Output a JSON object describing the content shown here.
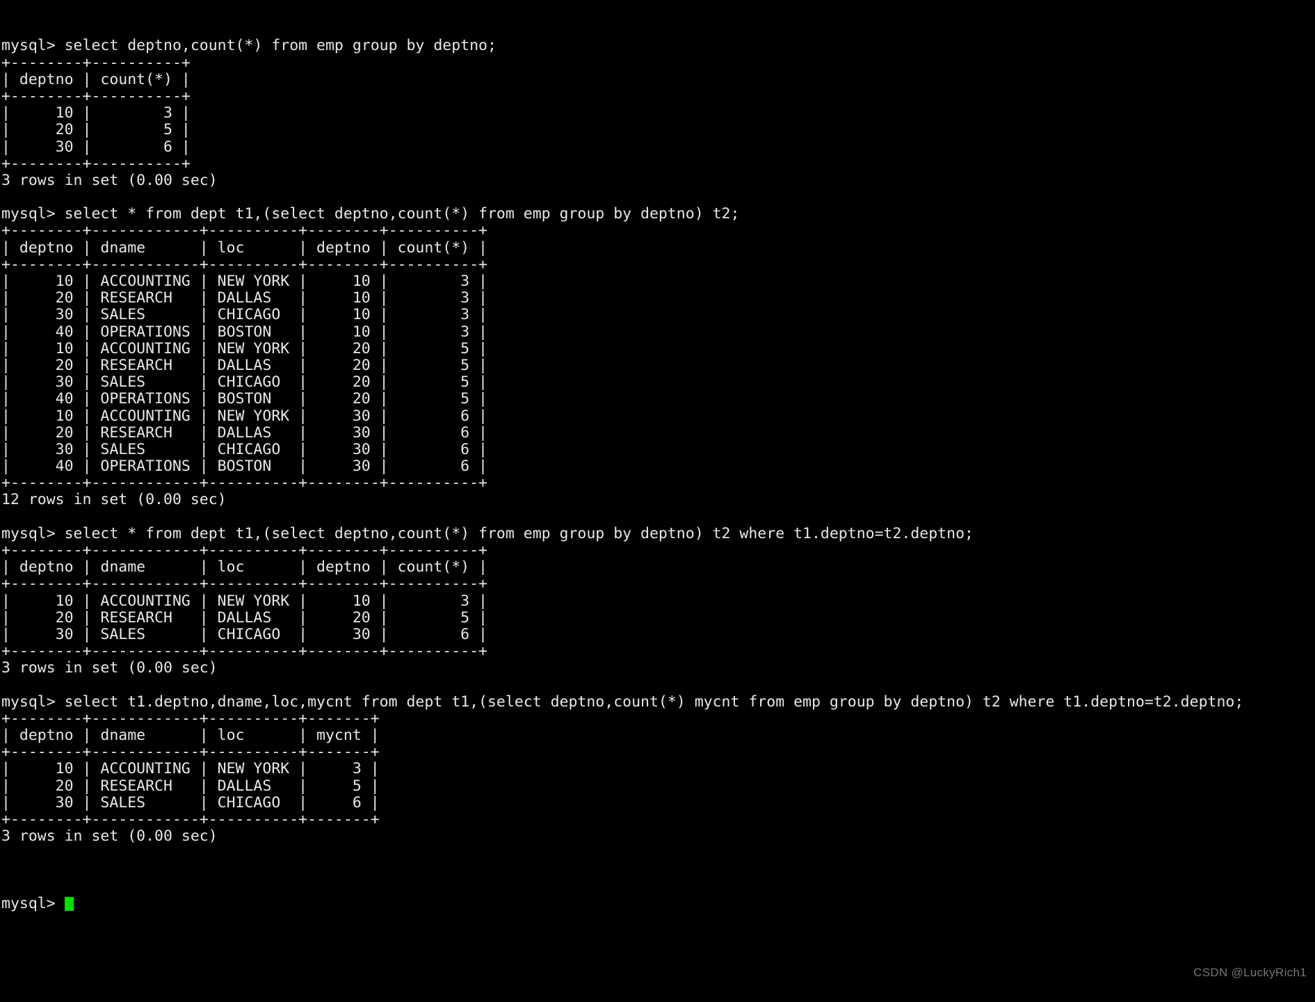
{
  "terminal": {
    "title": "mysql",
    "prompt": "mysql> ",
    "background_color": "#000000",
    "text_color": "#e8e8e8",
    "cursor_color": "#00e000",
    "lines": [
      "mysql> select deptno,count(*) from emp group by deptno;",
      "+--------+----------+",
      "| deptno | count(*) |",
      "+--------+----------+",
      "|     10 |        3 |",
      "|     20 |        5 |",
      "|     30 |        6 |",
      "+--------+----------+",
      "3 rows in set (0.00 sec)",
      "",
      "mysql> select * from dept t1,(select deptno,count(*) from emp group by deptno) t2;",
      "+--------+------------+----------+--------+----------+",
      "| deptno | dname      | loc      | deptno | count(*) |",
      "+--------+------------+----------+--------+----------+",
      "|     10 | ACCOUNTING | NEW YORK |     10 |        3 |",
      "|     20 | RESEARCH   | DALLAS   |     10 |        3 |",
      "|     30 | SALES      | CHICAGO  |     10 |        3 |",
      "|     40 | OPERATIONS | BOSTON   |     10 |        3 |",
      "|     10 | ACCOUNTING | NEW YORK |     20 |        5 |",
      "|     20 | RESEARCH   | DALLAS   |     20 |        5 |",
      "|     30 | SALES      | CHICAGO  |     20 |        5 |",
      "|     40 | OPERATIONS | BOSTON   |     20 |        5 |",
      "|     10 | ACCOUNTING | NEW YORK |     30 |        6 |",
      "|     20 | RESEARCH   | DALLAS   |     30 |        6 |",
      "|     30 | SALES      | CHICAGO  |     30 |        6 |",
      "|     40 | OPERATIONS | BOSTON   |     30 |        6 |",
      "+--------+------------+----------+--------+----------+",
      "12 rows in set (0.00 sec)",
      "",
      "mysql> select * from dept t1,(select deptno,count(*) from emp group by deptno) t2 where t1.deptno=t2.deptno;",
      "+--------+------------+----------+--------+----------+",
      "| deptno | dname      | loc      | deptno | count(*) |",
      "+--------+------------+----------+--------+----------+",
      "|     10 | ACCOUNTING | NEW YORK |     10 |        3 |",
      "|     20 | RESEARCH   | DALLAS   |     20 |        5 |",
      "|     30 | SALES      | CHICAGO  |     30 |        6 |",
      "+--------+------------+----------+--------+----------+",
      "3 rows in set (0.00 sec)",
      "",
      "mysql> select t1.deptno,dname,loc,mycnt from dept t1,(select deptno,count(*) mycnt from emp group by deptno) t2 where t1.deptno=t2.deptno;",
      "+--------+------------+----------+-------+",
      "| deptno | dname      | loc      | mycnt |",
      "+--------+------------+----------+-------+",
      "|     10 | ACCOUNTING | NEW YORK |     3 |",
      "|     20 | RESEARCH   | DALLAS   |     5 |",
      "|     30 | SALES      | CHICAGO  |     6 |",
      "+--------+------------+----------+-------+",
      "3 rows in set (0.00 sec)",
      ""
    ],
    "final_prompt": "mysql>"
  },
  "queries": [
    {
      "sql": "select deptno,count(*) from emp group by deptno;",
      "columns": [
        "deptno",
        "count(*)"
      ],
      "rows": [
        [
          "10",
          "3"
        ],
        [
          "20",
          "5"
        ],
        [
          "30",
          "6"
        ]
      ],
      "status": "3 rows in set (0.00 sec)"
    },
    {
      "sql": "select * from dept t1,(select deptno,count(*) from emp group by deptno) t2;",
      "columns": [
        "deptno",
        "dname",
        "loc",
        "deptno",
        "count(*)"
      ],
      "rows": [
        [
          "10",
          "ACCOUNTING",
          "NEW YORK",
          "10",
          "3"
        ],
        [
          "20",
          "RESEARCH",
          "DALLAS",
          "10",
          "3"
        ],
        [
          "30",
          "SALES",
          "CHICAGO",
          "10",
          "3"
        ],
        [
          "40",
          "OPERATIONS",
          "BOSTON",
          "10",
          "3"
        ],
        [
          "10",
          "ACCOUNTING",
          "NEW YORK",
          "20",
          "5"
        ],
        [
          "20",
          "RESEARCH",
          "DALLAS",
          "20",
          "5"
        ],
        [
          "30",
          "SALES",
          "CHICAGO",
          "20",
          "5"
        ],
        [
          "40",
          "OPERATIONS",
          "BOSTON",
          "20",
          "5"
        ],
        [
          "10",
          "ACCOUNTING",
          "NEW YORK",
          "30",
          "6"
        ],
        [
          "20",
          "RESEARCH",
          "DALLAS",
          "30",
          "6"
        ],
        [
          "30",
          "SALES",
          "CHICAGO",
          "30",
          "6"
        ],
        [
          "40",
          "OPERATIONS",
          "BOSTON",
          "30",
          "6"
        ]
      ],
      "status": "12 rows in set (0.00 sec)"
    },
    {
      "sql": "select * from dept t1,(select deptno,count(*) from emp group by deptno) t2 where t1.deptno=t2.deptno;",
      "columns": [
        "deptno",
        "dname",
        "loc",
        "deptno",
        "count(*)"
      ],
      "rows": [
        [
          "10",
          "ACCOUNTING",
          "NEW YORK",
          "10",
          "3"
        ],
        [
          "20",
          "RESEARCH",
          "DALLAS",
          "20",
          "5"
        ],
        [
          "30",
          "SALES",
          "CHICAGO",
          "30",
          "6"
        ]
      ],
      "status": "3 rows in set (0.00 sec)"
    },
    {
      "sql": "select t1.deptno,dname,loc,mycnt from dept t1,(select deptno,count(*) mycnt from emp group by deptno) t2 where t1.deptno=t2.deptno;",
      "columns": [
        "deptno",
        "dname",
        "loc",
        "mycnt"
      ],
      "rows": [
        [
          "10",
          "ACCOUNTING",
          "NEW YORK",
          "3"
        ],
        [
          "20",
          "RESEARCH",
          "DALLAS",
          "5"
        ],
        [
          "30",
          "SALES",
          "CHICAGO",
          "6"
        ]
      ],
      "status": "3 rows in set (0.00 sec)"
    }
  ],
  "watermark": {
    "text": "CSDN @LuckyRich1"
  }
}
